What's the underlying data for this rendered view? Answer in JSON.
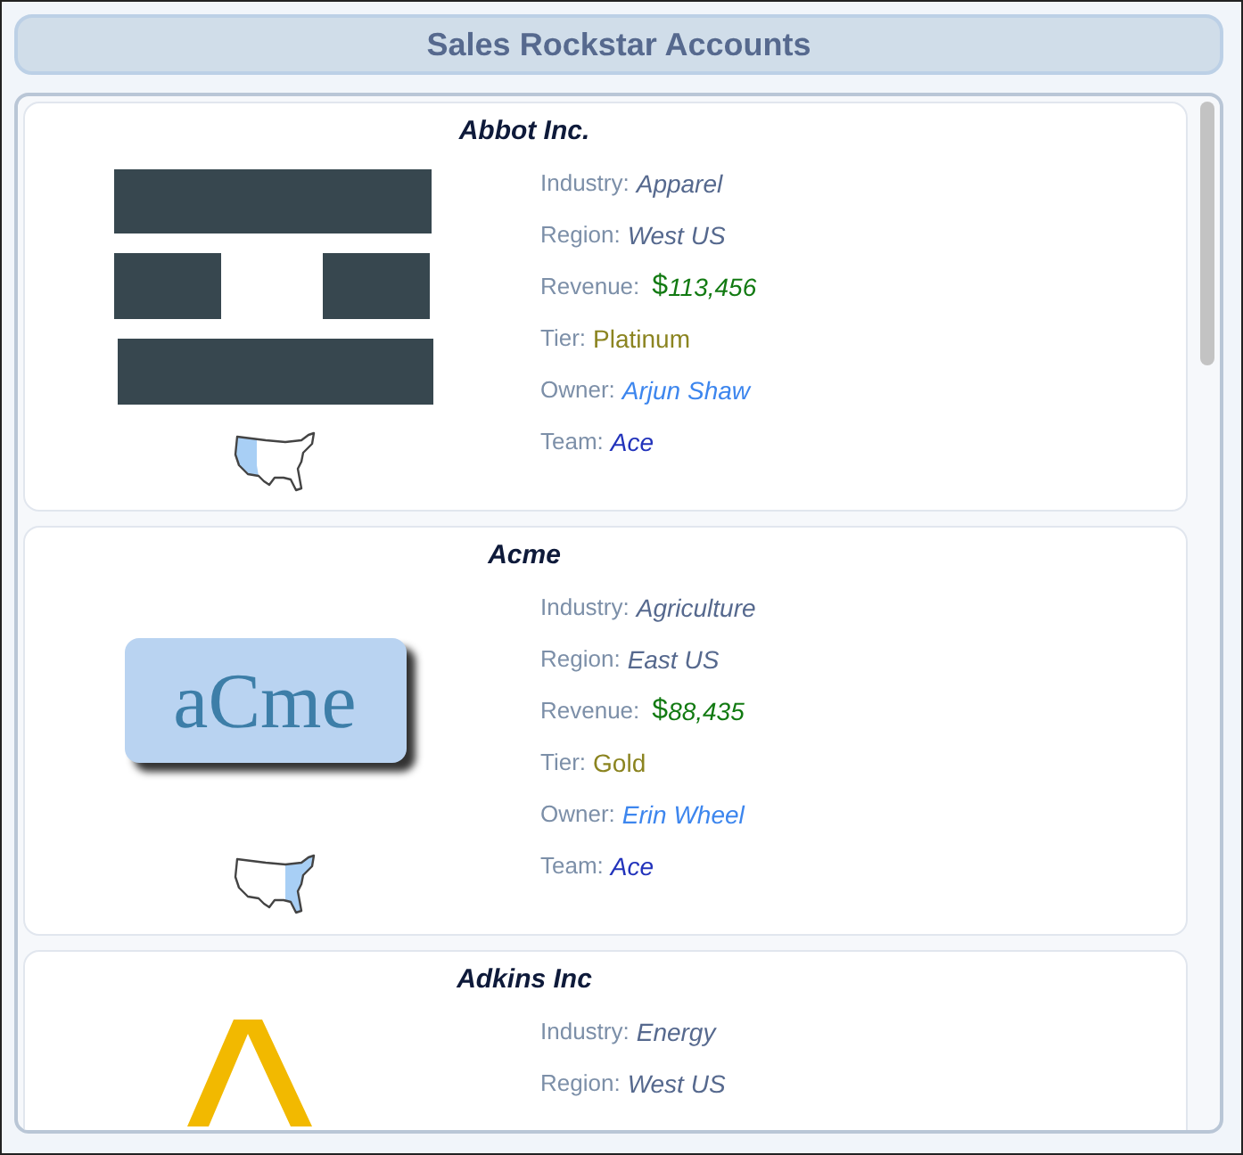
{
  "header": {
    "title": "Sales Rockstar Accounts"
  },
  "accounts": [
    {
      "name": "Abbot Inc.",
      "logo": {
        "kind": "blocks"
      },
      "map": {
        "west": true,
        "east": false
      },
      "fields": [
        {
          "kind": "industry",
          "label": "Industry:",
          "value": "Apparel"
        },
        {
          "kind": "region",
          "label": "Region:",
          "value": "West US"
        },
        {
          "kind": "revenue",
          "label": "Revenue:",
          "currency": "$",
          "value": "113,456"
        },
        {
          "kind": "tier",
          "label": "Tier:",
          "value": "Platinum"
        },
        {
          "kind": "owner",
          "label": "Owner:",
          "value": "Arjun Shaw"
        },
        {
          "kind": "team",
          "label": "Team:",
          "value": "Ace"
        }
      ]
    },
    {
      "name": "Acme",
      "logo": {
        "kind": "wordmark",
        "text": "aCme"
      },
      "map": {
        "west": false,
        "east": true
      },
      "fields": [
        {
          "kind": "industry",
          "label": "Industry:",
          "value": "Agriculture"
        },
        {
          "kind": "region",
          "label": "Region:",
          "value": "East US"
        },
        {
          "kind": "revenue",
          "label": "Revenue:",
          "currency": "$",
          "value": "88,435"
        },
        {
          "kind": "tier",
          "label": "Tier:",
          "value": "Gold"
        },
        {
          "kind": "owner",
          "label": "Owner:",
          "value": "Erin Wheel"
        },
        {
          "kind": "team",
          "label": "Team:",
          "value": "Ace"
        }
      ]
    },
    {
      "name": "Adkins Inc",
      "logo": {
        "kind": "chevron"
      },
      "fields": [
        {
          "kind": "industry",
          "label": "Industry:",
          "value": "Energy"
        },
        {
          "kind": "region",
          "label": "Region:",
          "value": "West US"
        }
      ]
    }
  ]
}
